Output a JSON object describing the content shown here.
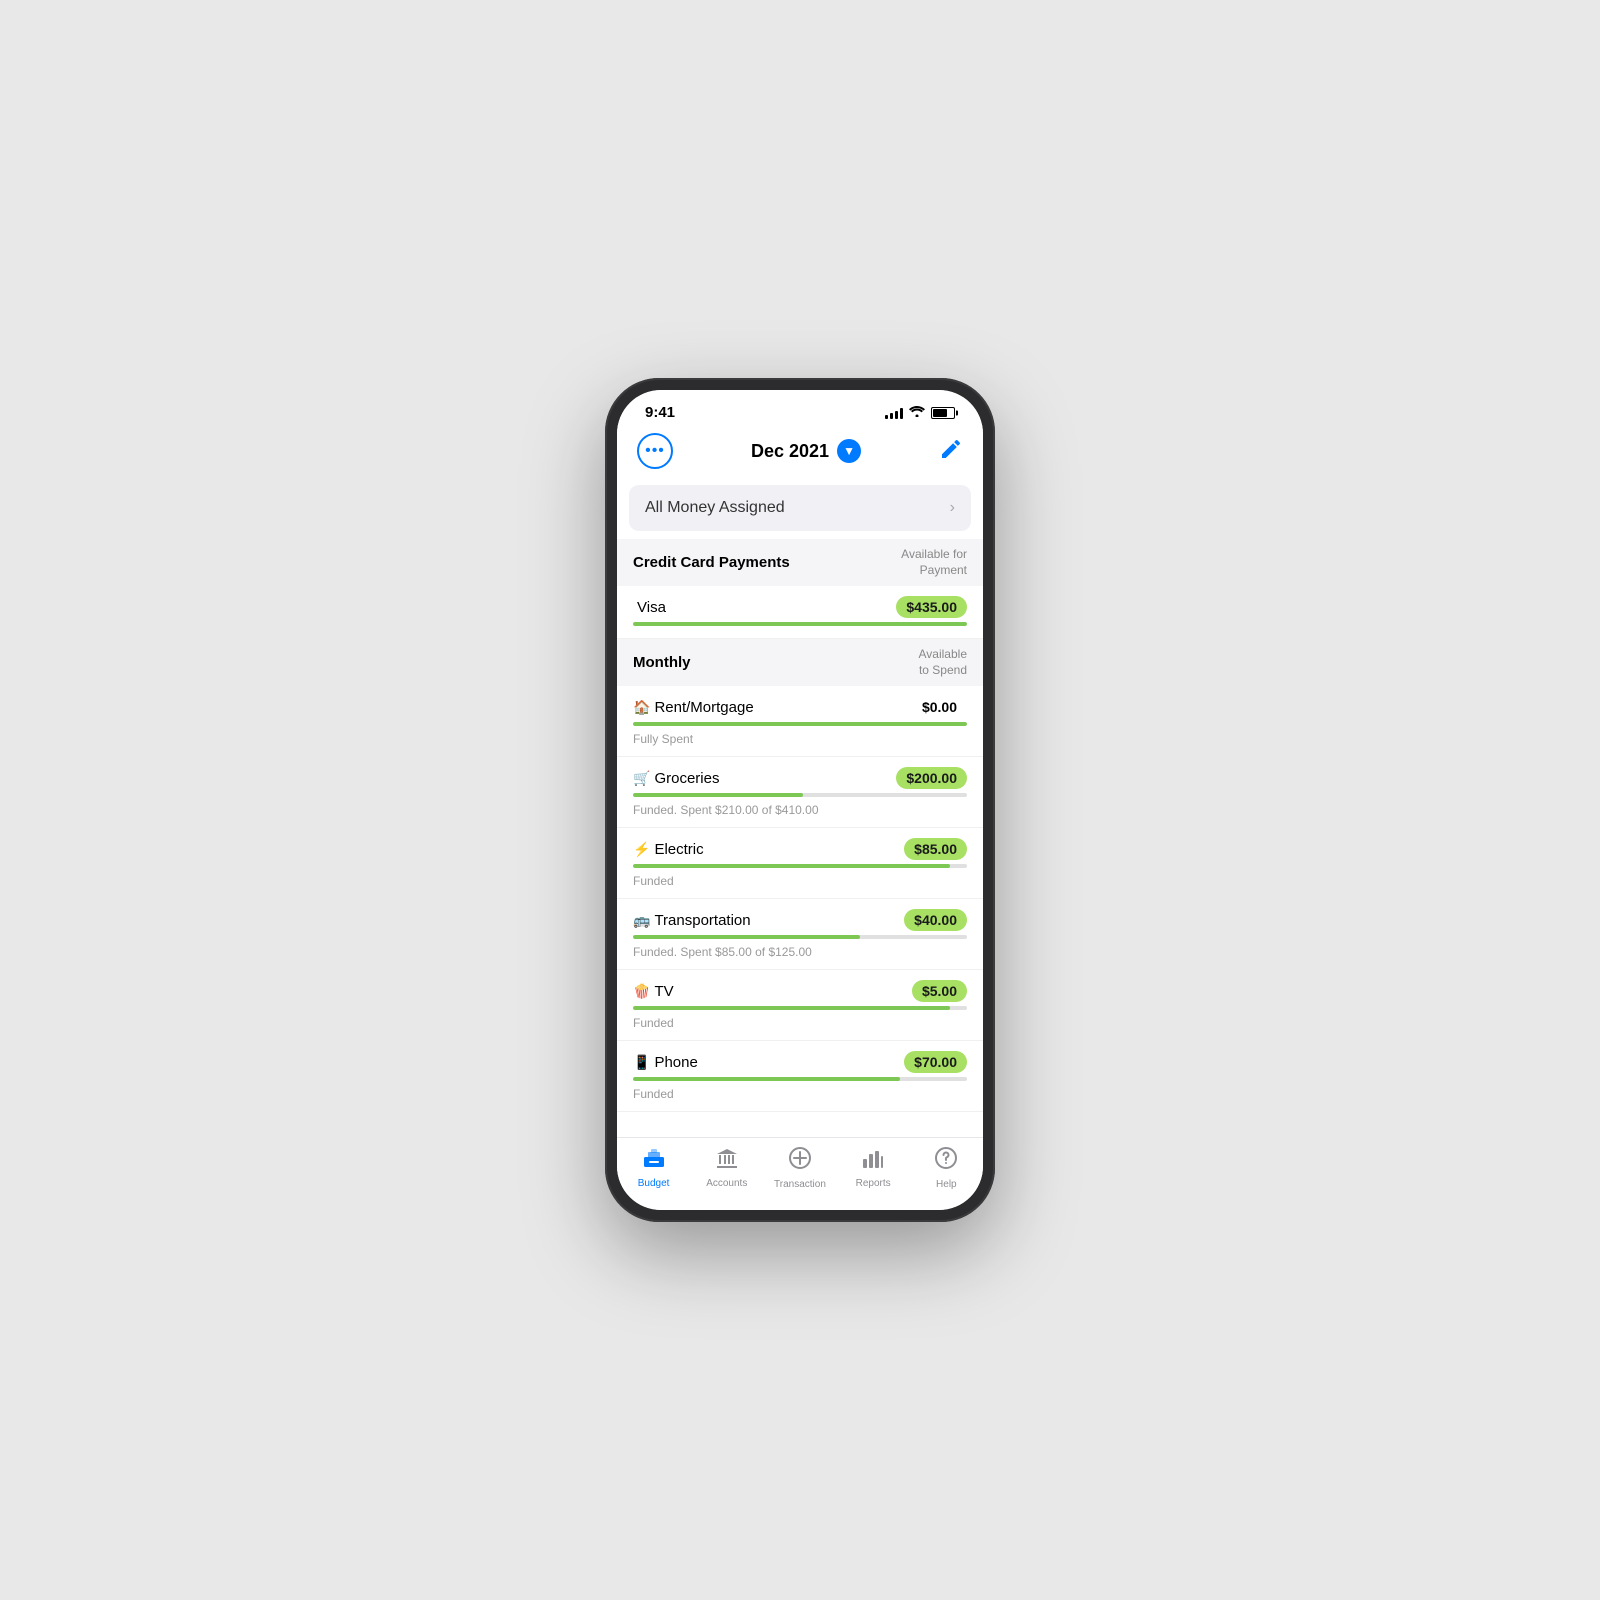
{
  "statusBar": {
    "time": "9:41"
  },
  "header": {
    "title": "Dec 2021",
    "editIcon": "✏️"
  },
  "banner": {
    "text": "All Money Assigned"
  },
  "sections": [
    {
      "id": "credit-card",
      "title": "Credit Card Payments",
      "subtitle": "Available for\nPayment",
      "rows": [
        {
          "emoji": "",
          "name": "Visa",
          "amount": "$435.00",
          "progress": 100,
          "status": "",
          "badgeStyle": "green",
          "isZero": false
        }
      ]
    },
    {
      "id": "monthly",
      "title": "Monthly",
      "subtitle": "Available\nto Spend",
      "rows": [
        {
          "emoji": "🏠",
          "name": "Rent/Mortgage",
          "amount": "$0.00",
          "progress": 100,
          "status": "Fully Spent",
          "badgeStyle": "zero",
          "isZero": true
        },
        {
          "emoji": "🛒",
          "name": "Groceries",
          "amount": "$200.00",
          "progress": 51,
          "status": "Funded. Spent $210.00 of $410.00",
          "badgeStyle": "green",
          "isZero": false
        },
        {
          "emoji": "⚡",
          "name": "Electric",
          "amount": "$85.00",
          "progress": 95,
          "status": "Funded",
          "badgeStyle": "green",
          "isZero": false
        },
        {
          "emoji": "🚌",
          "name": "Transportation",
          "amount": "$40.00",
          "progress": 68,
          "status": "Funded. Spent $85.00 of $125.00",
          "badgeStyle": "green",
          "isZero": false
        },
        {
          "emoji": "🍿",
          "name": "TV",
          "amount": "$5.00",
          "progress": 95,
          "status": "Funded",
          "badgeStyle": "green",
          "isZero": false
        },
        {
          "emoji": "📱",
          "name": "Phone",
          "amount": "$70.00",
          "progress": 80,
          "status": "Funded",
          "badgeStyle": "green",
          "isZero": false
        }
      ]
    }
  ],
  "tabs": [
    {
      "id": "budget",
      "label": "Budget",
      "icon": "🏦",
      "active": true
    },
    {
      "id": "accounts",
      "label": "Accounts",
      "icon": "🏛️",
      "active": false
    },
    {
      "id": "transaction",
      "label": "Transaction",
      "icon": "➕",
      "active": false
    },
    {
      "id": "reports",
      "label": "Reports",
      "icon": "📊",
      "active": false
    },
    {
      "id": "help",
      "label": "Help",
      "icon": "❓",
      "active": false
    }
  ]
}
